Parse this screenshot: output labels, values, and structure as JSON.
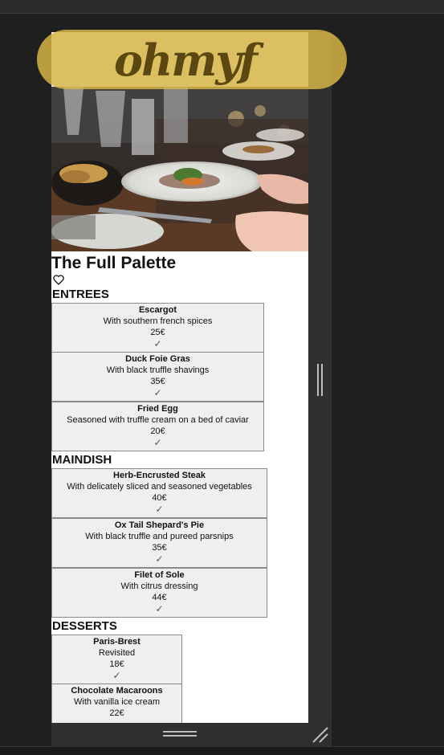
{
  "logo": "ohmyf",
  "restaurant": {
    "title": "The Full Palette"
  },
  "icons": {
    "heart": "heart-outline-icon",
    "check": "checkmark-icon",
    "resize": "resize-grip-icon"
  },
  "sections": [
    {
      "title": "ENTREES",
      "items": [
        {
          "name": "Escargot",
          "description": "With southern french spices",
          "price": "25€",
          "check": "✓"
        },
        {
          "name": "Duck Foie Gras",
          "description": "With black truffle shavings",
          "price": "35€",
          "check": "✓"
        },
        {
          "name": "Fried Egg",
          "description": "Seasoned with truffle cream on a bed of caviar",
          "price": "20€",
          "check": "✓"
        }
      ]
    },
    {
      "title": "MAINDISH",
      "items": [
        {
          "name": "Herb-Encrusted Steak",
          "description": "With delicately sliced and seasoned vegetables",
          "price": "40€",
          "check": "✓"
        },
        {
          "name": "Ox Tail Shepard's Pie",
          "description": "With black truffle and pureed parsnips",
          "price": "35€",
          "check": "✓"
        },
        {
          "name": "Filet of Sole",
          "description": "With citrus dressing",
          "price": "44€",
          "check": "✓"
        }
      ]
    },
    {
      "title": "DESSERTS",
      "items": [
        {
          "name": "Paris-Brest",
          "description": "Revisited",
          "price": "18€",
          "check": "✓"
        },
        {
          "name": "Chocolate Macaroons",
          "description": "With vanilla ice cream",
          "price": "22€",
          "check": ""
        }
      ]
    }
  ]
}
